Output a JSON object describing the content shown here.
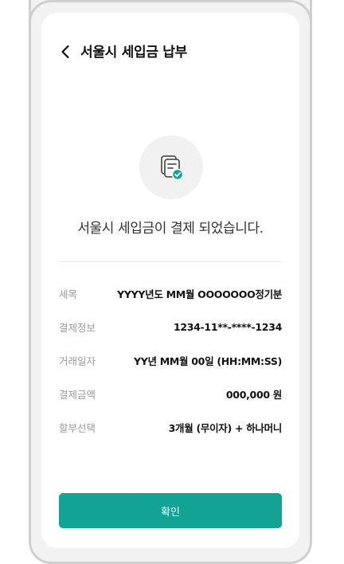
{
  "header": {
    "back_icon": "chevron-left-icon",
    "title": "서울시 세입금 납부"
  },
  "hero": {
    "icon": "document-check-icon",
    "message": "서울시 세입금이 결제 되었습니다."
  },
  "details": [
    {
      "label": "세목",
      "value": "YYYY년도 MM월 OOOOOOO정기분"
    },
    {
      "label": "결제정보",
      "value": "1234-11**-****-1234"
    },
    {
      "label": "거래일자",
      "value": "YY년 MM월 00일 (HH:MM:SS)"
    },
    {
      "label": "결제금액",
      "value": "000,000 원"
    },
    {
      "label": "할부선택",
      "value": "3개월 (무이자) + 하나머니"
    }
  ],
  "confirm_label": "확인",
  "colors": {
    "accent": "#12a394",
    "icon_check": "#12a394",
    "label_gray": "#9a9a9a"
  }
}
